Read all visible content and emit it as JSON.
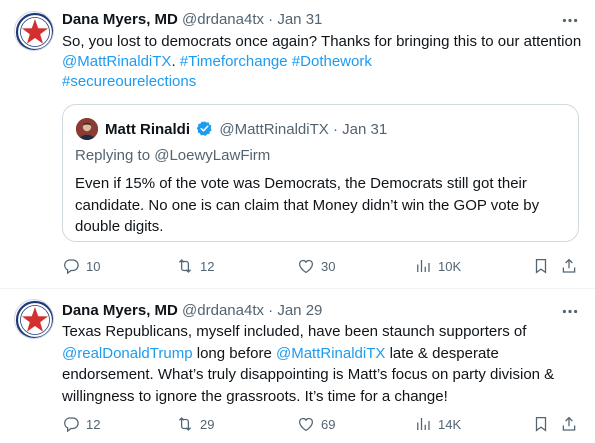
{
  "tweets": [
    {
      "author_name": "Dana Myers, MD",
      "handle": "@drdana4tx",
      "separator": "·",
      "date": "Jan 31",
      "text_plain_1": "So, you lost to democrats once again? Thanks for bringing this to our attention ",
      "mention_1": "@MattRinaldiTX",
      "hashtag_1": "#Timeforchange",
      "hashtag_2": "#Dothework",
      "hashtag_3": "#secureourelections",
      "quote": {
        "author_name": "Matt Rinaldi",
        "handle": "@MattRinaldiTX",
        "separator": "·",
        "date": "Jan 31",
        "replying_to": "Replying to @LoewyLawFirm",
        "text": "Even if 15% of the vote was Democrats, the Democrats still got their candidate. No one is can claim that Money didn’t win the GOP vote by double digits."
      },
      "stats": {
        "replies": "10",
        "reposts": "12",
        "likes": "30",
        "views": "10K"
      }
    },
    {
      "author_name": "Dana Myers, MD",
      "handle": "@drdana4tx",
      "separator": "·",
      "date": "Jan 29",
      "text_plain_1": "Texas Republicans, myself included, have been staunch supporters of ",
      "mention_1": "@realDonaldTrump",
      "text_plain_2": " long before ",
      "mention_2": "@MattRinaldiTX",
      "text_plain_3": " late & desperate endorsement. What’s truly disappointing is Matt’s focus on party division & willingness to ignore the grassroots. It’s time for a change!",
      "stats": {
        "replies": "12",
        "reposts": "29",
        "likes": "69",
        "views": "14K"
      }
    }
  ],
  "colors": {
    "link": "#1d9bf0",
    "muted": "#536471",
    "text": "#0f1419",
    "border": "#cfd9de",
    "verified": "#1d9bf0"
  },
  "icons": [
    "more-icon",
    "reply-icon",
    "repost-icon",
    "like-icon",
    "views-icon",
    "bookmark-icon",
    "share-icon",
    "verified-badge-icon"
  ]
}
